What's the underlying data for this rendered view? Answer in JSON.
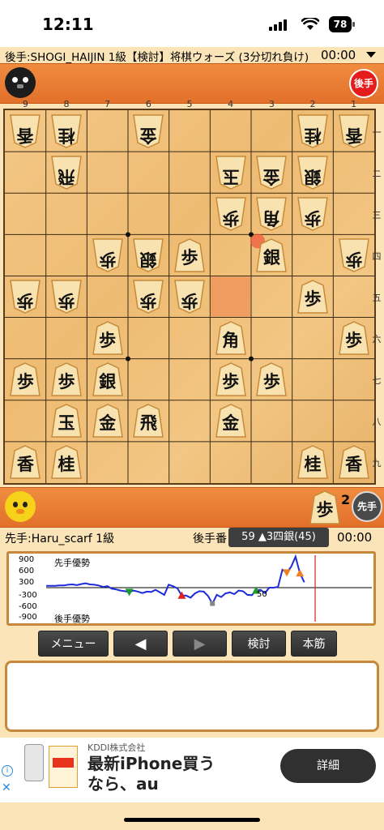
{
  "status": {
    "time": "12:11",
    "battery": "78"
  },
  "gote_info": {
    "player": "後手:SHOGI_HAIJIN 1級【検討】将棋ウォーズ (3分切れ負け)",
    "clock": "00:00"
  },
  "gote_hand": {
    "badge": "後手"
  },
  "board": {
    "files": [
      "9",
      "8",
      "7",
      "6",
      "5",
      "4",
      "3",
      "2",
      "1"
    ],
    "ranks": [
      "一",
      "二",
      "三",
      "四",
      "五",
      "六",
      "七",
      "八",
      "九"
    ],
    "pieces": [
      {
        "file": 9,
        "rank": 1,
        "char": "香",
        "side": "gote"
      },
      {
        "file": 8,
        "rank": 1,
        "char": "桂",
        "side": "gote"
      },
      {
        "file": 6,
        "rank": 1,
        "char": "金",
        "side": "gote"
      },
      {
        "file": 2,
        "rank": 1,
        "char": "桂",
        "side": "gote"
      },
      {
        "file": 1,
        "rank": 1,
        "char": "香",
        "side": "gote"
      },
      {
        "file": 8,
        "rank": 2,
        "char": "飛",
        "side": "gote"
      },
      {
        "file": 4,
        "rank": 2,
        "char": "玉",
        "side": "gote"
      },
      {
        "file": 3,
        "rank": 2,
        "char": "金",
        "side": "gote"
      },
      {
        "file": 2,
        "rank": 2,
        "char": "銀",
        "side": "gote"
      },
      {
        "file": 4,
        "rank": 3,
        "char": "歩",
        "side": "gote"
      },
      {
        "file": 3,
        "rank": 3,
        "char": "角",
        "side": "gote"
      },
      {
        "file": 2,
        "rank": 3,
        "char": "歩",
        "side": "gote"
      },
      {
        "file": 7,
        "rank": 4,
        "char": "歩",
        "side": "gote"
      },
      {
        "file": 6,
        "rank": 4,
        "char": "銀",
        "side": "gote"
      },
      {
        "file": 5,
        "rank": 4,
        "char": "歩",
        "side": "sente"
      },
      {
        "file": 3,
        "rank": 4,
        "char": "銀",
        "side": "sente"
      },
      {
        "file": 1,
        "rank": 4,
        "char": "歩",
        "side": "gote"
      },
      {
        "file": 9,
        "rank": 5,
        "char": "歩",
        "side": "gote"
      },
      {
        "file": 8,
        "rank": 5,
        "char": "歩",
        "side": "gote"
      },
      {
        "file": 6,
        "rank": 5,
        "char": "歩",
        "side": "gote"
      },
      {
        "file": 5,
        "rank": 5,
        "char": "歩",
        "side": "gote"
      },
      {
        "file": 2,
        "rank": 5,
        "char": "歩",
        "side": "sente"
      },
      {
        "file": 7,
        "rank": 6,
        "char": "歩",
        "side": "sente"
      },
      {
        "file": 4,
        "rank": 6,
        "char": "角",
        "side": "sente"
      },
      {
        "file": 1,
        "rank": 6,
        "char": "歩",
        "side": "sente"
      },
      {
        "file": 9,
        "rank": 7,
        "char": "歩",
        "side": "sente"
      },
      {
        "file": 8,
        "rank": 7,
        "char": "歩",
        "side": "sente"
      },
      {
        "file": 7,
        "rank": 7,
        "char": "銀",
        "side": "sente"
      },
      {
        "file": 4,
        "rank": 7,
        "char": "歩",
        "side": "sente"
      },
      {
        "file": 3,
        "rank": 7,
        "char": "歩",
        "side": "sente"
      },
      {
        "file": 8,
        "rank": 8,
        "char": "玉",
        "side": "sente"
      },
      {
        "file": 7,
        "rank": 8,
        "char": "金",
        "side": "sente"
      },
      {
        "file": 6,
        "rank": 8,
        "char": "飛",
        "side": "sente"
      },
      {
        "file": 4,
        "rank": 8,
        "char": "金",
        "side": "sente"
      },
      {
        "file": 9,
        "rank": 9,
        "char": "香",
        "side": "sente"
      },
      {
        "file": 8,
        "rank": 9,
        "char": "桂",
        "side": "sente"
      },
      {
        "file": 2,
        "rank": 9,
        "char": "桂",
        "side": "sente"
      },
      {
        "file": 1,
        "rank": 9,
        "char": "香",
        "side": "sente"
      }
    ],
    "last_move_from": {
      "file": 4,
      "rank": 5
    },
    "last_move_to": {
      "file": 3,
      "rank": 4
    }
  },
  "sente_hand": {
    "piece": "歩",
    "count": "2",
    "badge": "先手"
  },
  "sente_info": {
    "player": "先手:Haru_scarf 1級",
    "turn": "後手番",
    "move": "59 ▲3四銀(45)",
    "clock": "00:00"
  },
  "graph": {
    "y_labels": [
      "900",
      "600",
      "300",
      "-300",
      "-600",
      "-900"
    ],
    "sente_label": "先手優勢",
    "gote_label": "後手優勢",
    "move_label": "50",
    "evaluations": [
      50,
      50,
      50,
      60,
      60,
      80,
      90,
      70,
      100,
      120,
      90,
      80,
      60,
      20,
      40,
      -30,
      -50,
      -80,
      -100,
      -120,
      -80,
      -110,
      -150,
      -110,
      -120,
      -60,
      -130,
      -200,
      80,
      40,
      -20,
      -220,
      -220,
      -280,
      -160,
      -100,
      -110,
      -230,
      -440,
      -200,
      -260,
      -160,
      -130,
      -180,
      -80,
      -100,
      -200,
      -210,
      -80,
      -60,
      -150,
      0,
      0,
      20,
      500,
      420,
      580,
      860,
      400,
      150
    ]
  },
  "buttons": {
    "menu": "メニュー",
    "prev": "◀",
    "next": "▶",
    "review": "検討",
    "main_line": "本筋"
  },
  "comment": "",
  "ad": {
    "company": "KDDI株式会社",
    "headline": "最新iPhone買う\nなら、au",
    "cta": "詳細"
  }
}
